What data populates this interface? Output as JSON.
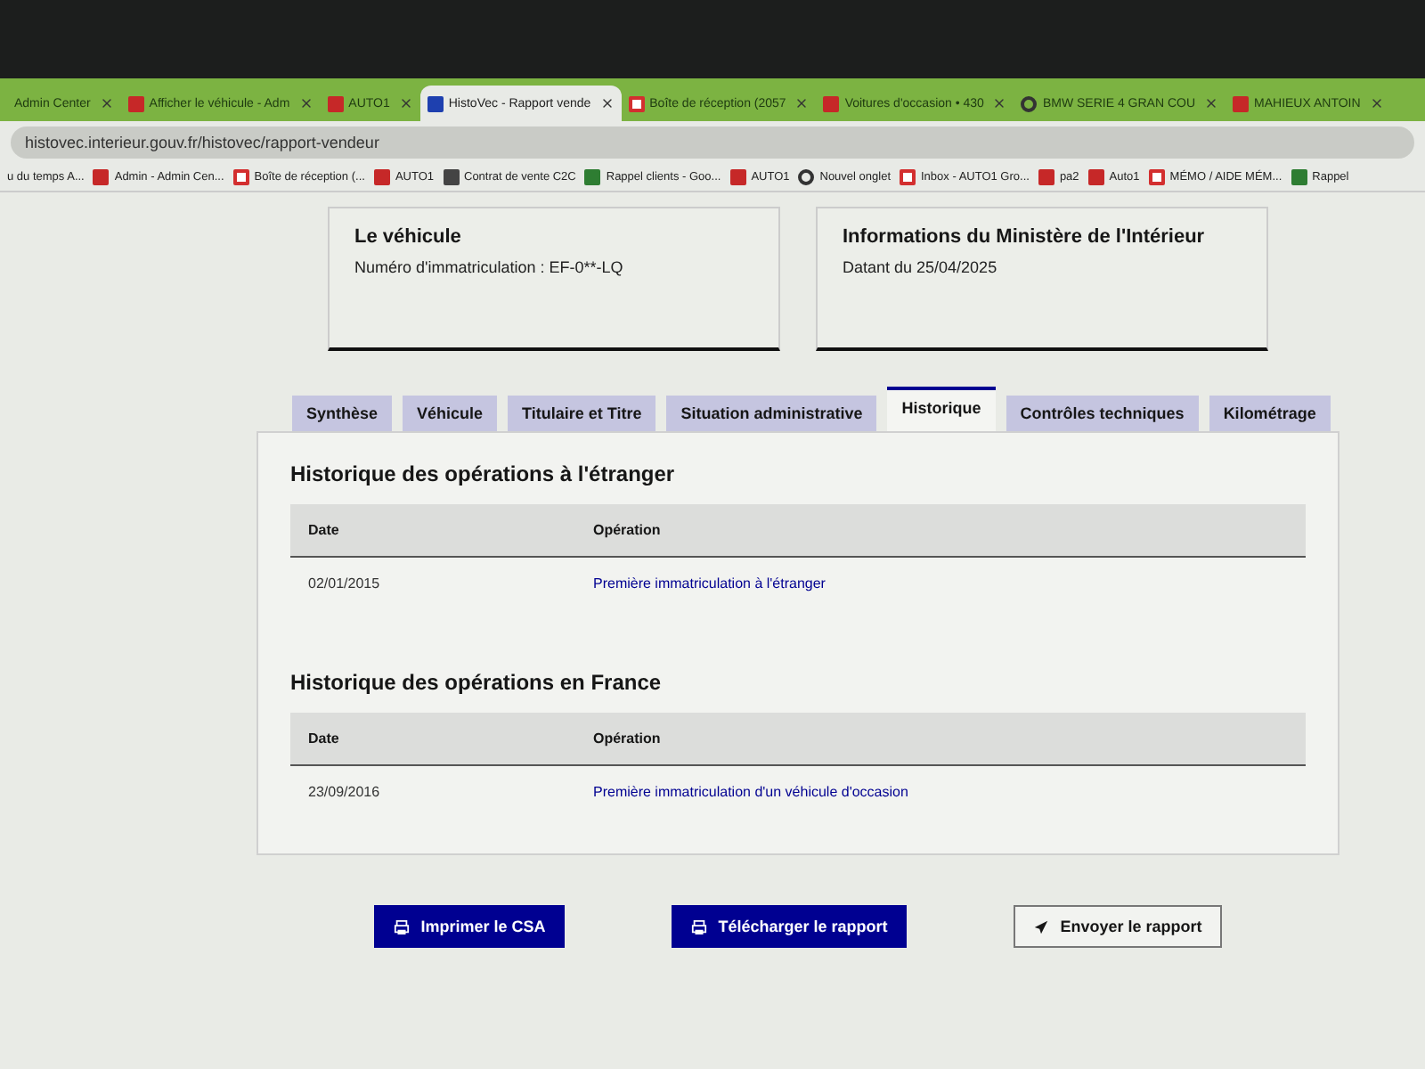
{
  "browser": {
    "tabs": [
      {
        "title": "Admin Center",
        "selected": false
      },
      {
        "title": "Afficher le véhicule - Adm",
        "selected": false
      },
      {
        "title": "AUTO1",
        "selected": false
      },
      {
        "title": "HistoVec - Rapport vende",
        "selected": true
      },
      {
        "title": "Boîte de réception (2057",
        "selected": false
      },
      {
        "title": "Voitures d'occasion • 430",
        "selected": false
      },
      {
        "title": "BMW SERIE 4 GRAN COU",
        "selected": false
      },
      {
        "title": "MAHIEUX ANTOIN",
        "selected": false
      }
    ],
    "address": "histovec.interieur.gouv.fr/histovec/rapport-vendeur",
    "bookmarks": [
      "u du temps A...",
      "Admin - Admin Cen...",
      "Boîte de réception (...",
      "AUTO1",
      "Contrat de vente C2C",
      "Rappel clients - Goo...",
      "AUTO1",
      "Nouvel onglet",
      "Inbox - AUTO1 Gro...",
      "pa2",
      "Auto1",
      "MÉMO / AIDE MÉM...",
      "Rappel"
    ]
  },
  "cards": [
    {
      "title": "Le véhicule",
      "text": "Numéro d'immatriculation : EF-0**-LQ"
    },
    {
      "title": "Informations du Ministère de l'Intérieur",
      "text": "Datant du 25/04/2025"
    }
  ],
  "tabs": [
    {
      "label": "Synthèse",
      "selected": false
    },
    {
      "label": "Véhicule",
      "selected": false
    },
    {
      "label": "Titulaire et Titre",
      "selected": false
    },
    {
      "label": "Situation administrative",
      "selected": false
    },
    {
      "label": "Historique",
      "selected": true
    },
    {
      "label": "Contrôles techniques",
      "selected": false
    },
    {
      "label": "Kilométrage",
      "selected": false
    }
  ],
  "sections": [
    {
      "title": "Historique des opérations à l'étranger",
      "columns": [
        "Date",
        "Opération"
      ],
      "rows": [
        [
          "02/01/2015",
          "Première immatriculation à l'étranger"
        ]
      ]
    },
    {
      "title": "Historique des opérations en France",
      "columns": [
        "Date",
        "Opération"
      ],
      "rows": [
        [
          "23/09/2016",
          "Première immatriculation d'un véhicule d'occasion"
        ]
      ]
    }
  ],
  "buttons": [
    {
      "label": "Imprimer le CSA",
      "kind": "primary"
    },
    {
      "label": "Télécharger le rapport",
      "kind": "primary"
    },
    {
      "label": "Envoyer le rapport",
      "kind": "secondary"
    }
  ]
}
